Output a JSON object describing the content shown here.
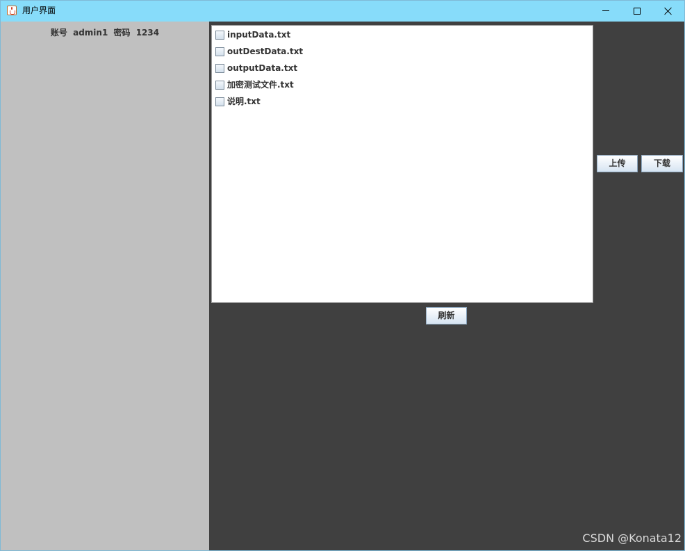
{
  "window": {
    "title": "用户界面",
    "icon": "java-coffee-icon",
    "controls": {
      "minimize": "minimize-icon",
      "maximize": "maximize-icon",
      "close": "close-icon"
    }
  },
  "account": {
    "account_label": "账号",
    "account_value": "admin1",
    "password_label": "密码",
    "password_value": "1234"
  },
  "files": [
    {
      "name": "inputData.txt",
      "checked": false
    },
    {
      "name": "outDestData.txt",
      "checked": false
    },
    {
      "name": "outputData.txt",
      "checked": false
    },
    {
      "name": "加密测试文件.txt",
      "checked": false
    },
    {
      "name": "说明.txt",
      "checked": false
    }
  ],
  "actions": {
    "upload_label": "上传",
    "download_label": "下载",
    "refresh_label": "刷新"
  },
  "watermark": "CSDN @Konata12",
  "colors": {
    "titlebar": "#87dcfa",
    "left_panel": "#c0c0c0",
    "main_background": "#404040",
    "list_background": "#ffffff"
  }
}
